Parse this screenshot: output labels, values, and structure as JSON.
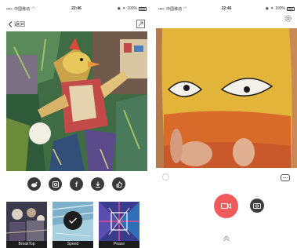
{
  "left": {
    "status": {
      "carrier": "••••◦ 中国移动",
      "time": "22:46",
      "battery": "100%"
    },
    "navbar": {
      "back_label": "返回"
    },
    "actions": [
      "weibo-icon",
      "instagram-icon",
      "facebook-icon",
      "download-icon",
      "like-icon"
    ],
    "facebook_glyph": "f",
    "filters": [
      {
        "label": "BreakTop",
        "selected": false
      },
      {
        "label": "Speed",
        "selected": true
      },
      {
        "label": "Peace",
        "selected": false
      }
    ]
  },
  "right": {
    "status": {
      "carrier": "••••◦ 中国移动",
      "time": "22:46",
      "battery": "100%"
    }
  },
  "colors": {
    "record": "#f25b5b",
    "dark": "#3a3a3a"
  }
}
